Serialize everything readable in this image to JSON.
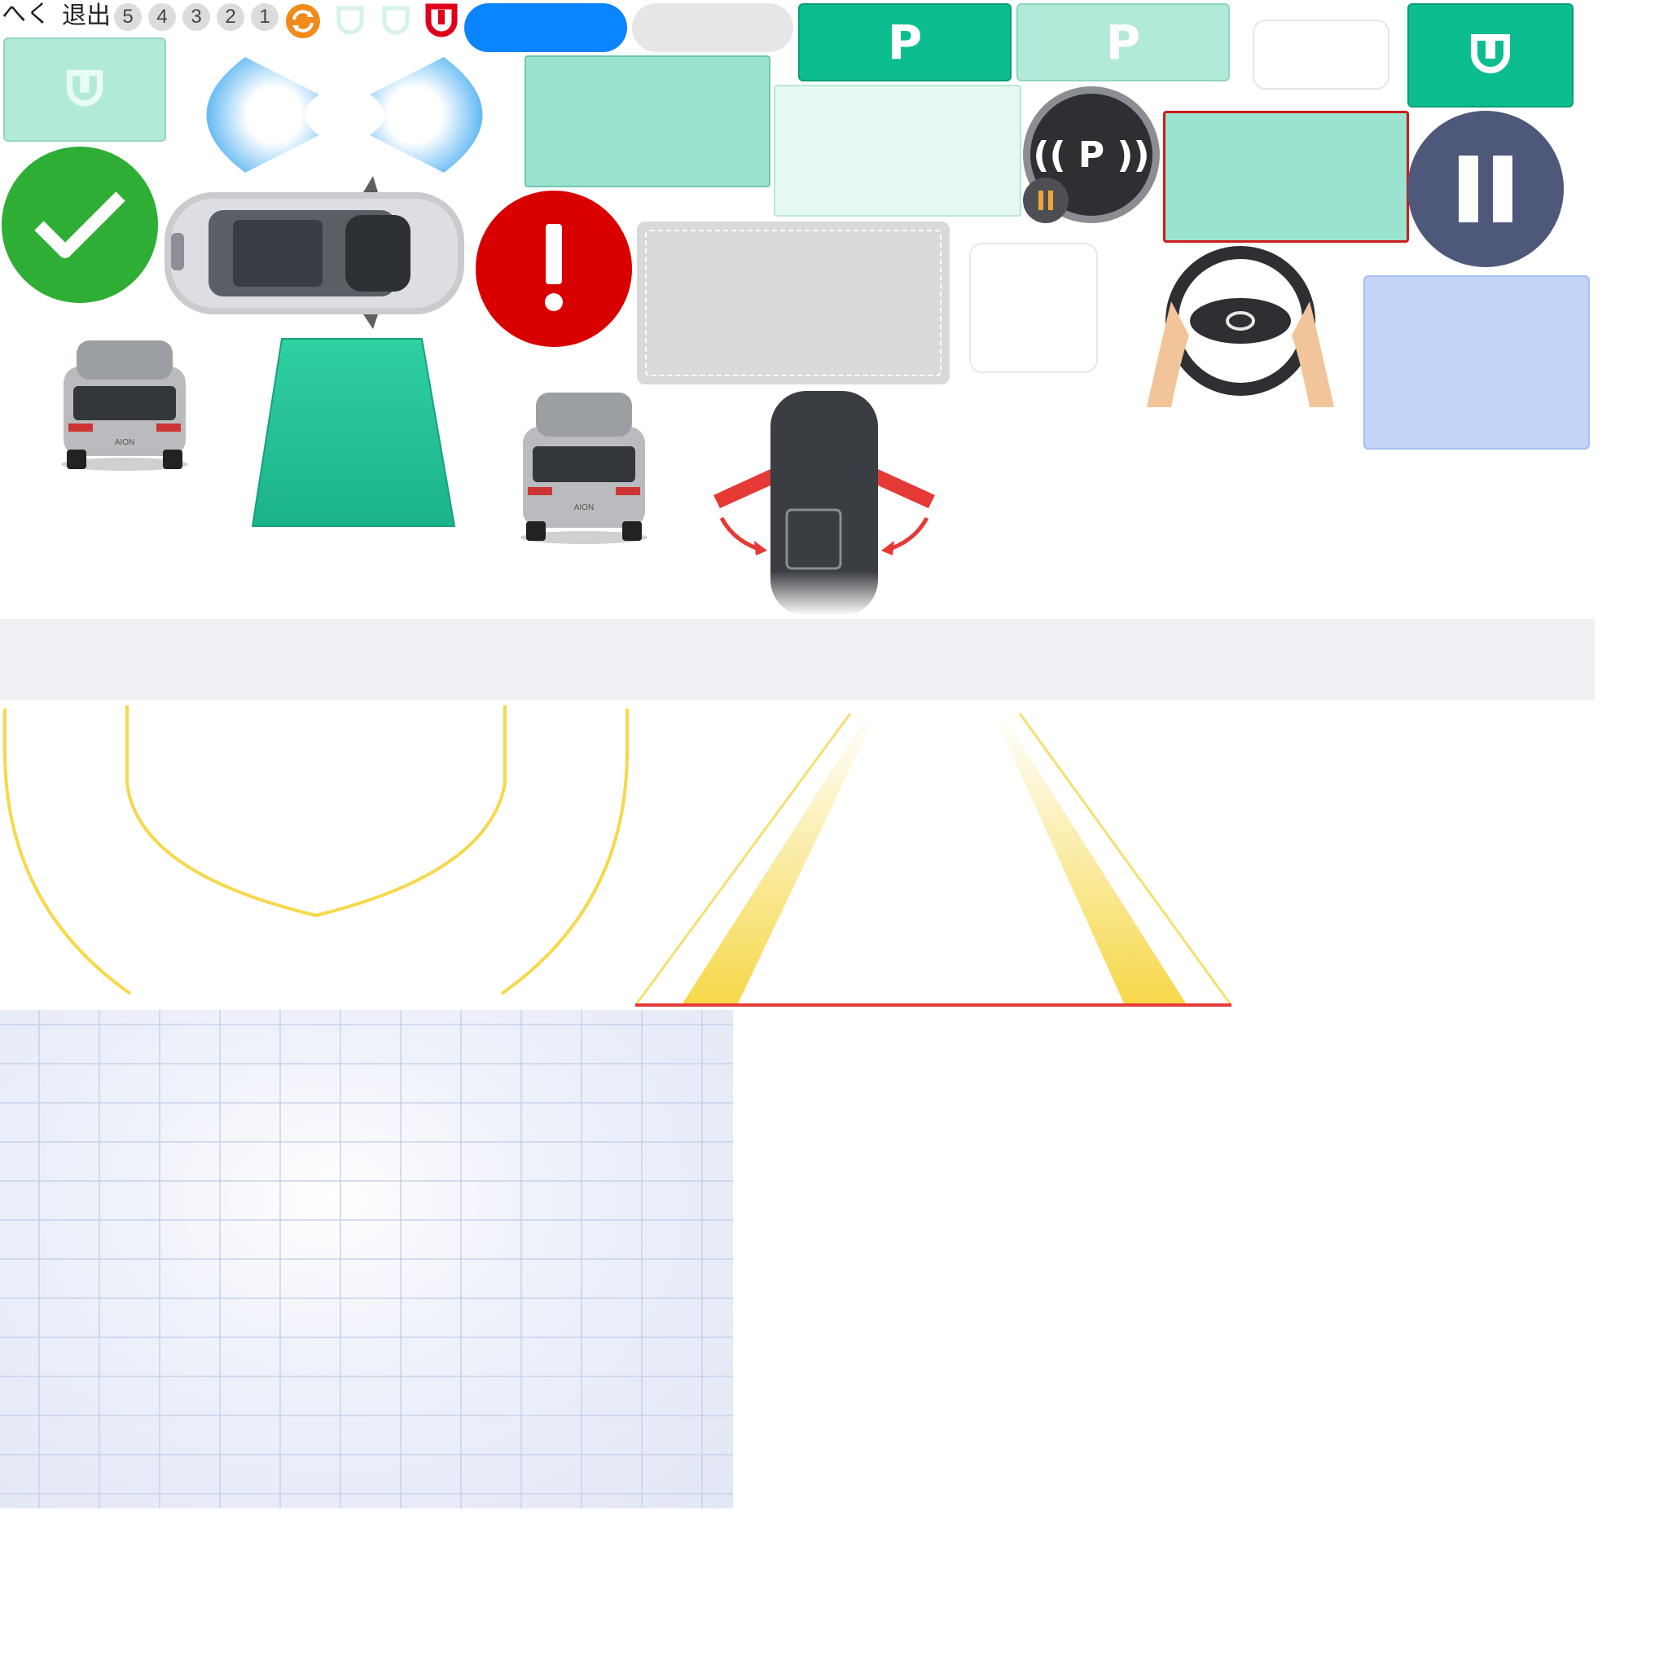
{
  "header": {
    "back_glyph": "へく",
    "exit_label": "退出"
  },
  "countdown": [
    "5",
    "4",
    "3",
    "2",
    "1"
  ],
  "parking_buttons": {
    "p_label_1": "P",
    "p_label_2": "P",
    "p_label_3": "P",
    "p_wave_label": "(( P ))"
  },
  "brand": {
    "car_badge": "AION"
  },
  "colors": {
    "accent_green": "#0bbd8f",
    "light_green": "#b2ead9",
    "blue_pill": "#0a84ff",
    "success": "#2fae36",
    "alert": "#d90000",
    "slate": "#4e587a",
    "lavender": "#c4d4f7",
    "lane_yellow": "#f6d84a",
    "stop_red": "#e53935"
  },
  "icons": [
    "back-icon",
    "refresh-icon",
    "parking-outline-icon",
    "parking-red-icon",
    "check-icon",
    "alert-icon",
    "pause-icon",
    "steering-wheel-icon",
    "parking-sensor-icon"
  ]
}
